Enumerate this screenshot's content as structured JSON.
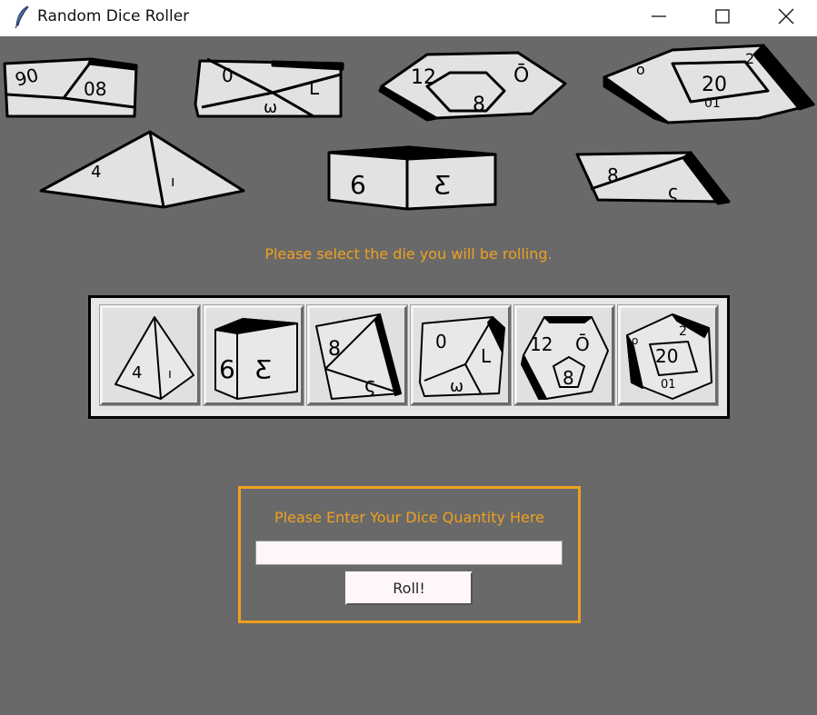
{
  "window": {
    "title": "Random Dice Roller",
    "icon": "feather-icon",
    "controls": [
      "minimize-icon",
      "maximize-icon",
      "close-icon"
    ]
  },
  "colors": {
    "background": "#696969",
    "accent": "#f0a020",
    "button_face": "#e0e0e0",
    "input_bg": "#fff7f7"
  },
  "banner": {
    "dice": [
      "d10",
      "d8",
      "d12",
      "d20",
      "d4",
      "d6",
      "d8"
    ]
  },
  "dice_prompt": "Please select the die you will be rolling.",
  "dice_buttons": [
    {
      "die": "d4",
      "icon": "d4-die-icon"
    },
    {
      "die": "d6",
      "icon": "d6-die-icon"
    },
    {
      "die": "d8",
      "icon": "d8-die-icon"
    },
    {
      "die": "d10",
      "icon": "d10-die-icon"
    },
    {
      "die": "d12",
      "icon": "d12-die-icon"
    },
    {
      "die": "d20",
      "icon": "d20-die-icon"
    }
  ],
  "quantity": {
    "label": "Please Enter Your Dice Quantity Here",
    "value": "",
    "placeholder": ""
  },
  "roll_button": "Roll!"
}
